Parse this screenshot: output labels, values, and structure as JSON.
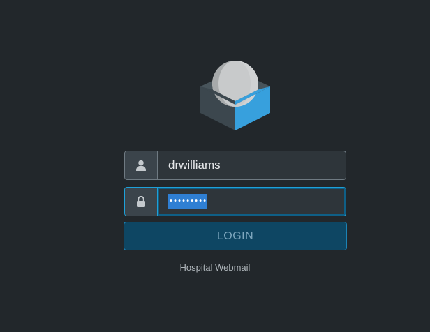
{
  "login_form": {
    "username": {
      "icon": "user-icon",
      "value": "drwilliams"
    },
    "password": {
      "icon": "lock-icon",
      "masked_value": "•••••••••"
    },
    "submit_label": "LOGIN"
  },
  "footer": {
    "product_name": "Hospital Webmail"
  },
  "colors": {
    "background": "#22272b",
    "accent_blue": "#2f9fdb",
    "button_bg": "#0e4663",
    "focus_border": "#1ea0d8"
  },
  "logo": {
    "icon": "roundcube-logo-icon"
  }
}
